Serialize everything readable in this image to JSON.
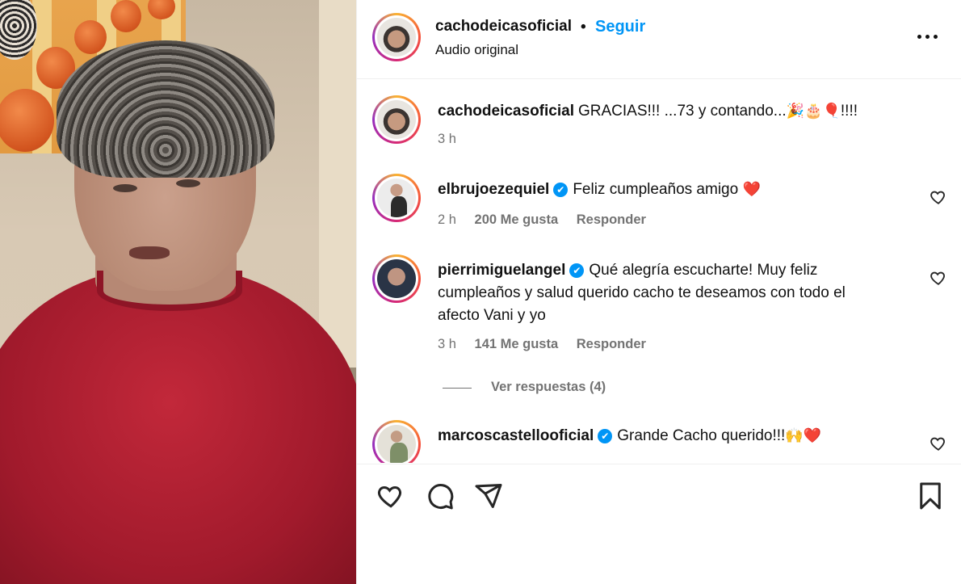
{
  "post": {
    "author": "cachodeicasoficial",
    "dot": "•",
    "follow_label": "Seguir",
    "audio_label": "Audio original",
    "more_icon": "more-horizontal-icon"
  },
  "caption": {
    "username": "cachodeicasoficial",
    "text": "GRACIAS!!! ...73 y contando...",
    "emoji": "🎉🎂🎈",
    "suffix": "!!!!",
    "time": "3 h"
  },
  "comments": [
    {
      "username": "elbrujoezequiel",
      "verified": true,
      "text": "Feliz cumpleaños amigo",
      "emoji": "❤️",
      "time": "2 h",
      "likes": "200 Me gusta",
      "reply": "Responder"
    },
    {
      "username": "pierrimiguelangel",
      "verified": true,
      "text": "Qué alegría escucharte! Muy feliz cumpleaños y salud querido cacho te deseamos con todo el afecto Vani y yo",
      "time": "3 h",
      "likes": "141 Me gusta",
      "reply": "Responder",
      "view_replies": "Ver respuestas (4)"
    },
    {
      "username": "marcoscastellooficial",
      "verified": true,
      "text": "Grande Cacho querido!!!",
      "emoji": "🙌❤️"
    }
  ],
  "badge_glyph": "✔",
  "colors": {
    "accent": "#0095f6",
    "text": "#111111",
    "muted": "#737373",
    "heart": "#e0243a"
  }
}
